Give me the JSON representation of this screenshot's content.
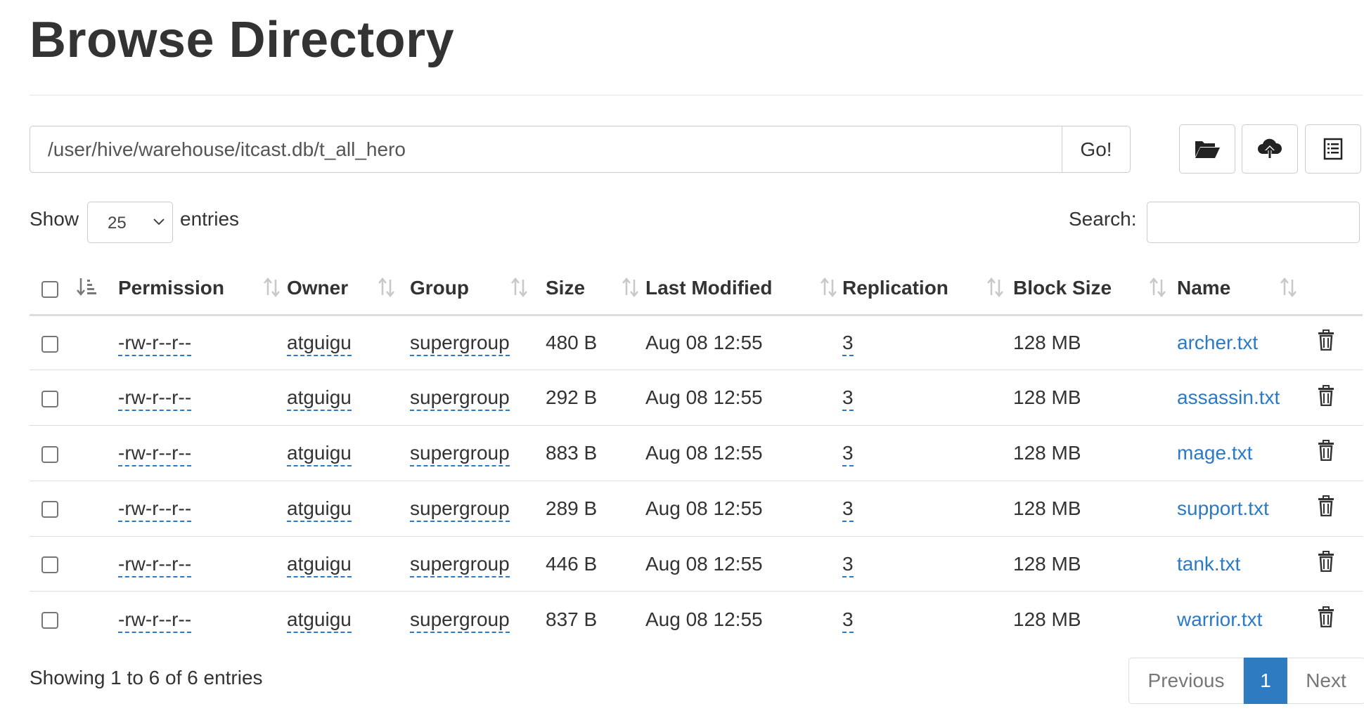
{
  "page": {
    "title": "Browse Directory"
  },
  "path_bar": {
    "value": "/user/hive/warehouse/itcast.db/t_all_hero",
    "go_label": "Go!"
  },
  "toolbar": {
    "icons": [
      "folder-open-icon",
      "cloud-upload-icon",
      "list-icon"
    ]
  },
  "entries": {
    "show_label": "Show",
    "selected": "25",
    "suffix_label": "entries"
  },
  "search": {
    "label": "Search:",
    "value": ""
  },
  "table": {
    "headers": [
      "Permission",
      "Owner",
      "Group",
      "Size",
      "Last Modified",
      "Replication",
      "Block Size",
      "Name"
    ],
    "rows": [
      {
        "permission": "-rw-r--r--",
        "owner": "atguigu",
        "group": "supergroup",
        "size": "480 B",
        "modified": "Aug 08 12:55",
        "replication": "3",
        "block_size": "128 MB",
        "name": "archer.txt"
      },
      {
        "permission": "-rw-r--r--",
        "owner": "atguigu",
        "group": "supergroup",
        "size": "292 B",
        "modified": "Aug 08 12:55",
        "replication": "3",
        "block_size": "128 MB",
        "name": "assassin.txt"
      },
      {
        "permission": "-rw-r--r--",
        "owner": "atguigu",
        "group": "supergroup",
        "size": "883 B",
        "modified": "Aug 08 12:55",
        "replication": "3",
        "block_size": "128 MB",
        "name": "mage.txt"
      },
      {
        "permission": "-rw-r--r--",
        "owner": "atguigu",
        "group": "supergroup",
        "size": "289 B",
        "modified": "Aug 08 12:55",
        "replication": "3",
        "block_size": "128 MB",
        "name": "support.txt"
      },
      {
        "permission": "-rw-r--r--",
        "owner": "atguigu",
        "group": "supergroup",
        "size": "446 B",
        "modified": "Aug 08 12:55",
        "replication": "3",
        "block_size": "128 MB",
        "name": "tank.txt"
      },
      {
        "permission": "-rw-r--r--",
        "owner": "atguigu",
        "group": "supergroup",
        "size": "837 B",
        "modified": "Aug 08 12:55",
        "replication": "3",
        "block_size": "128 MB",
        "name": "warrior.txt"
      }
    ]
  },
  "footer": {
    "info": "Showing 1 to 6 of 6 entries"
  },
  "pagination": {
    "previous": "Previous",
    "current": "1",
    "next": "Next"
  },
  "colors": {
    "link": "#2a7ac7",
    "active_page": "#2e7bbf",
    "border": "#dddddd"
  }
}
